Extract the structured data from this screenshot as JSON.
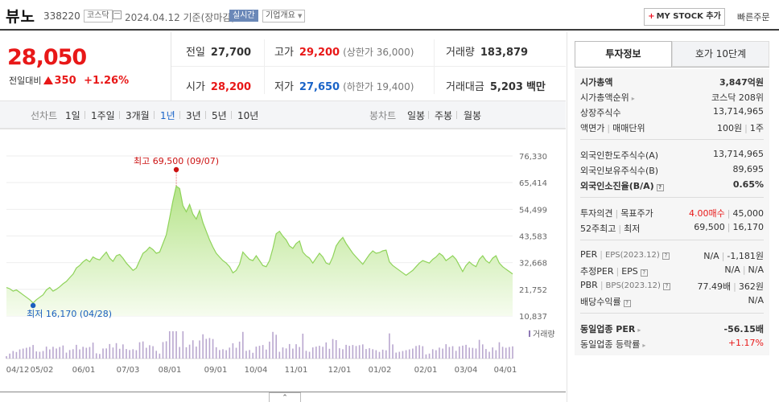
{
  "header": {
    "name": "뷰노",
    "code": "338220",
    "market": "코스닥",
    "date_text": "2024.04.12  기준(장마감)",
    "realtime_label": "실시간",
    "company_label": "기업개요",
    "mystock_label": "MY STOCK 추가",
    "quick_order_label": "빠른주문"
  },
  "price": {
    "current": "28,050",
    "change_label": "전일대비",
    "change_value": "350",
    "change_rate": "+1.26%"
  },
  "quotes": {
    "prev_label": "전일",
    "prev": "27,700",
    "high_label": "고가",
    "high": "29,200",
    "high_limit": "(상한가 36,000)",
    "volume_label": "거래량",
    "volume": "183,879",
    "open_label": "시가",
    "open": "28,200",
    "low_label": "저가",
    "low": "27,650",
    "low_limit": "(하한가 19,400)",
    "amount_label": "거래대금",
    "amount": "5,203",
    "amount_unit": "백만"
  },
  "periods": {
    "line_label": "선차트",
    "line_items": [
      "1일",
      "1주일",
      "3개월",
      "1년",
      "3년",
      "5년",
      "10년"
    ],
    "active": "1년",
    "candle_label": "봉차트",
    "candle_items": [
      "일봉",
      "주봉",
      "월봉"
    ]
  },
  "chart_data": {
    "type": "area",
    "y_ticks": [
      "76,330",
      "65,414",
      "54,499",
      "43,583",
      "32,668",
      "21,752",
      "10,837"
    ],
    "ylim": [
      10837,
      76330
    ],
    "x_ticks": [
      "04/12",
      "05/02",
      "06/01",
      "07/03",
      "08/01",
      "09/01",
      "10/04",
      "11/01",
      "12/01",
      "01/02",
      "02/01",
      "03/04",
      "04/01"
    ],
    "high_annotation": "최고 69,500 (09/07)",
    "low_annotation": "최저 16,170 (04/28)",
    "high": {
      "date": "09/07",
      "value": 69500
    },
    "low": {
      "date": "04/28",
      "value": 16170
    },
    "volume_legend": "거래량",
    "series": [
      {
        "values": [
          22500,
          22000,
          21000,
          21500,
          20500,
          19500,
          18500,
          17500,
          16170,
          17500,
          18500,
          19500,
          21500,
          22500,
          21000,
          21800,
          22800,
          24000,
          25000,
          26500,
          28000,
          30500,
          31500,
          33000,
          34000,
          33000,
          35000,
          34200,
          33800,
          35500,
          37000,
          34500,
          33200,
          35500,
          36000,
          34500,
          32500,
          31000,
          29500,
          30500,
          33500,
          36500,
          37500,
          39000,
          38000,
          36500,
          37000,
          40500,
          44000,
          51000,
          58000,
          64000,
          63000,
          56000,
          53500,
          56500,
          52500,
          50500,
          54000,
          49000,
          45500,
          42000,
          39000,
          36500,
          35000,
          33500,
          32500,
          31000,
          28500,
          29500,
          32000,
          37000,
          35500,
          34000,
          33500,
          35500,
          33500,
          31500,
          31000,
          33500,
          38500,
          44500,
          45500,
          43500,
          42000,
          39500,
          38500,
          40500,
          41500,
          37000,
          35500,
          34500,
          32500,
          34500,
          36500,
          35000,
          32500,
          32000,
          35000,
          39500,
          41500,
          43000,
          40500,
          38500,
          36500,
          35000,
          33500,
          32000,
          34000,
          36000,
          37500,
          36500,
          36800,
          37500,
          37800,
          33000,
          31500,
          30500,
          29500,
          28500,
          27500,
          28500,
          29500,
          31000,
          32500,
          33500,
          33000,
          32500,
          34000,
          35000,
          36500,
          35500,
          33500,
          34500,
          35500,
          34000,
          31500,
          29000,
          31500,
          33000,
          31800,
          31000,
          34000,
          35500,
          33500,
          32500,
          34500,
          35500,
          32500,
          31000,
          30000,
          29000,
          28050
        ]
      }
    ]
  },
  "right_panel": {
    "tab_active": "투자정보",
    "tab_other": "호가 10단계",
    "rows1": [
      {
        "label": "시가총액",
        "value": "3,847억원"
      },
      {
        "label": "시가총액순위",
        "value": "코스닥 208위"
      },
      {
        "label": "상장주식수",
        "value": "13,714,965"
      },
      {
        "label": "액면가",
        "label2": "매매단위",
        "value": "100원",
        "value2": "1주"
      }
    ],
    "rows2": [
      {
        "label": "외국인한도주식수(A)",
        "value": "13,714,965"
      },
      {
        "label": "외국인보유주식수(B)",
        "value": "89,695"
      },
      {
        "label": "외국인소진율(B/A)",
        "value": "0.65%"
      }
    ],
    "rows3": [
      {
        "label": "투자의견",
        "label2": "목표주가",
        "value": "4.00매수",
        "value2": "45,000"
      },
      {
        "label": "52주최고",
        "label2": "최저",
        "value": "69,500",
        "value2": "16,170"
      }
    ],
    "rows4": [
      {
        "label": "PER",
        "label2": "EPS(2023.12)",
        "value": "N/A",
        "value2": "-1,181원"
      },
      {
        "label": "추정PER",
        "label2": "EPS",
        "value": "N/A",
        "value2": "N/A"
      },
      {
        "label": "PBR",
        "label2": "BPS(2023.12)",
        "value": "77.49배",
        "value2": "362원"
      },
      {
        "label": "배당수익률",
        "value": "N/A"
      }
    ],
    "rows5": [
      {
        "label": "동일업종 PER",
        "value": "-56.15배"
      },
      {
        "label": "동일업종 등락률",
        "value": "+1.17%"
      }
    ]
  }
}
